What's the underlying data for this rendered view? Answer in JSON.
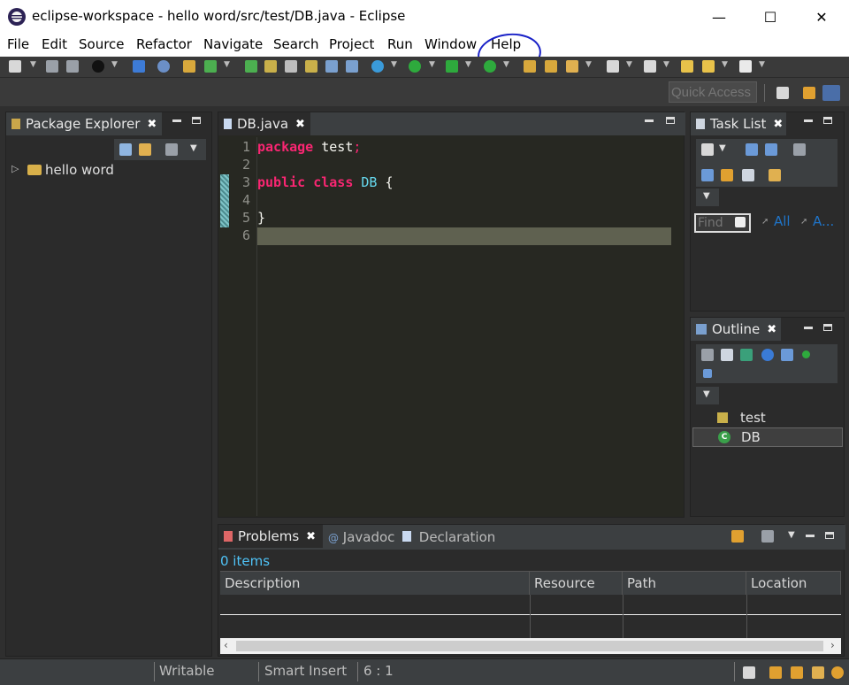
{
  "window": {
    "title": "eclipse-workspace - hello word/src/test/DB.java - Eclipse",
    "minimize": "—",
    "maximize": "☐",
    "close": "✕"
  },
  "menu": [
    "File",
    "Edit",
    "Source",
    "Refactor",
    "Navigate",
    "Search",
    "Project",
    "Run",
    "Window",
    "Help"
  ],
  "toolbar": {
    "quick_access_placeholder": "Quick Access"
  },
  "package_explorer": {
    "tab": "Package Explorer",
    "items": [
      {
        "label": "hello word",
        "icon": "java-project-icon"
      }
    ]
  },
  "editor": {
    "tab": "DB.java",
    "lines": [
      {
        "n": "1",
        "tokens": [
          {
            "t": "package ",
            "c": "kw"
          },
          {
            "t": "test",
            "c": "txt"
          },
          {
            "t": ";",
            "c": "semi"
          }
        ]
      },
      {
        "n": "2",
        "tokens": []
      },
      {
        "n": "3",
        "tokens": [
          {
            "t": "public ",
            "c": "kw"
          },
          {
            "t": "class ",
            "c": "kw"
          },
          {
            "t": "DB",
            "c": "cls"
          },
          {
            "t": " {",
            "c": "txt"
          }
        ]
      },
      {
        "n": "4",
        "tokens": []
      },
      {
        "n": "5",
        "tokens": [
          {
            "t": "}",
            "c": "txt"
          }
        ]
      },
      {
        "n": "6",
        "tokens": []
      }
    ],
    "current_line": "6"
  },
  "task_list": {
    "tab": "Task List",
    "find_placeholder": "Find",
    "filter_all": "All",
    "filter_a": "A..."
  },
  "outline": {
    "tab": "Outline",
    "items": [
      {
        "label": "test",
        "icon": "package-icon"
      },
      {
        "label": "DB",
        "icon": "class-icon"
      }
    ]
  },
  "bottom": {
    "tabs": [
      "Problems",
      "Javadoc",
      "Declaration"
    ],
    "count": "0 items",
    "columns": [
      "Description",
      "Resource",
      "Path",
      "Location"
    ]
  },
  "status": {
    "mode": "Writable",
    "insert": "Smart Insert",
    "position": "6 : 1"
  },
  "colors": {
    "keyword": "#f92672",
    "class": "#66d9ef",
    "editor_bg": "#272822",
    "help_annotation": "#1a22c8"
  }
}
